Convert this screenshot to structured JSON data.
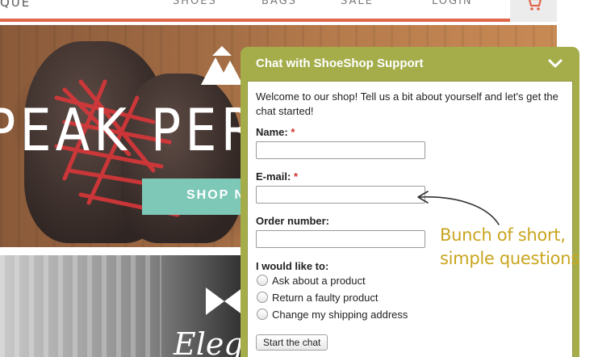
{
  "store": {
    "logo_text": "QUE",
    "nav": {
      "shoes": "SHOES",
      "bags": "BAGS",
      "sale": "SALE",
      "login": "LOGIN"
    },
    "hero": {
      "title": "PEAK PERF",
      "button_label": "SHOP N"
    },
    "banner_script": "Elega"
  },
  "chat": {
    "title": "Chat with ShoeShop Support",
    "intro": "Welcome to our shop! Tell us a bit about yourself and let's get the chat started!",
    "name_label": "Name:",
    "email_label": "E-mail:",
    "order_label": "Order number:",
    "required_marker": "*",
    "name_value": "",
    "email_value": "",
    "order_value": "",
    "options_label": "I would like to:",
    "options": [
      "Ask about a product",
      "Return a faulty product",
      "Change my shipping address"
    ],
    "start_button": "Start the chat"
  },
  "annotation": {
    "line1": "Bunch of short,",
    "line2": "simple questions"
  },
  "colors": {
    "chat_green": "#a5ad4b",
    "annotation_gold": "#c9a51f",
    "nav_underline": "#e0664a",
    "shop_button": "#7ec8b8"
  },
  "icons": {
    "cart": "cart-icon",
    "collapse": "chevron-down-icon",
    "mountain": "mountain-logo-icon",
    "bow": "bow-icon"
  }
}
